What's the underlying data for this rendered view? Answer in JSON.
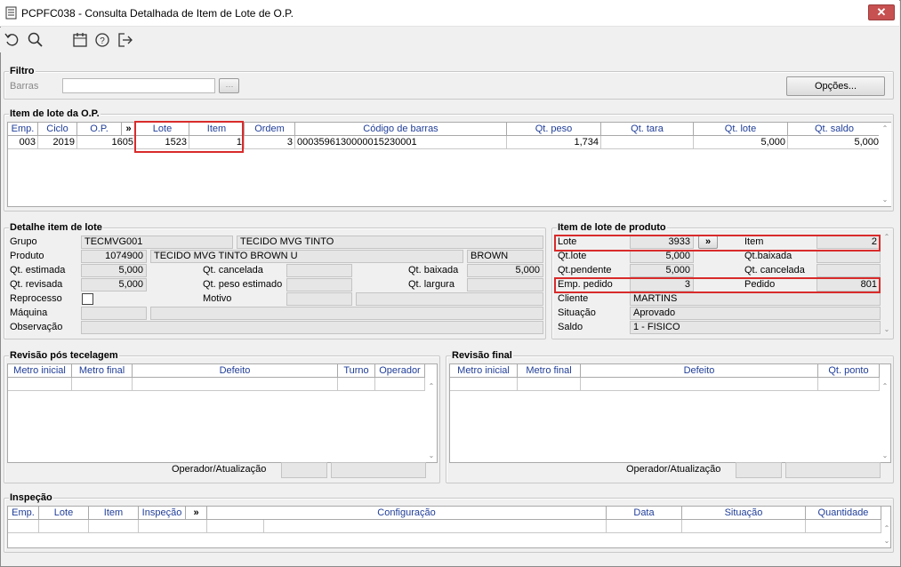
{
  "window": {
    "title": "PCPFC038 - Consulta Detalhada de Item de Lote de O.P.",
    "close_glyph": "✕"
  },
  "toolbar": {
    "icons": [
      "refresh-icon",
      "search-icon",
      "calendar-icon",
      "help-icon",
      "exit-icon"
    ]
  },
  "filtro": {
    "title": "Filtro",
    "barras_label": "Barras",
    "barras_value": "",
    "opcoes_label": "Opções..."
  },
  "item_lote_op": {
    "title": "Item de lote da O.P.",
    "headers": [
      "Emp.",
      "Ciclo",
      "O.P.",
      "»",
      "Lote",
      "Item",
      "Ordem",
      "Código de barras",
      "Qt. peso",
      "Qt. tara",
      "Qt. lote",
      "Qt. saldo"
    ],
    "rows": [
      [
        "003",
        "2019",
        "1605",
        "",
        "1523",
        "1",
        "3",
        "0003596130000015230001",
        "1,734",
        "",
        "5,000",
        "5,000"
      ]
    ]
  },
  "detalhe": {
    "title": "Detalhe item de lote",
    "grupo_label": "Grupo",
    "grupo_code": "TECMVG001",
    "grupo_desc": "TECIDO MVG TINTO",
    "produto_label": "Produto",
    "produto_code": "1074900",
    "produto_desc": "TECIDO MVG TINTO BROWN U",
    "produto_cor": "BROWN",
    "qt_estimada_label": "Qt. estimada",
    "qt_estimada": "5,000",
    "qt_cancelada_label": "Qt. cancelada",
    "qt_cancelada": "",
    "qt_baixada_label": "Qt. baixada",
    "qt_baixada": "5,000",
    "qt_revisada_label": "Qt. revisada",
    "qt_revisada": "5,000",
    "qt_peso_estimado_label": "Qt. peso estimado",
    "qt_peso_estimado": "",
    "qt_largura_label": "Qt. largura",
    "qt_largura": "",
    "reprocesso_label": "Reprocesso",
    "motivo_label": "Motivo",
    "maquina_label": "Máquina",
    "observacao_label": "Observação"
  },
  "produto": {
    "title": "Item de lote de produto",
    "lote_label": "Lote",
    "lote": "3933",
    "more_glyph": "»",
    "item_label": "Item",
    "item": "2",
    "qtlote_label": "Qt.lote",
    "qtlote": "5,000",
    "qtbaixada_label": "Qt.baixada",
    "qtbaixada": "",
    "qtpendente_label": "Qt.pendente",
    "qtpendente": "5,000",
    "qtcancelada_label": "Qt. cancelada",
    "qtcancelada": "",
    "emp_pedido_label": "Emp. pedido",
    "emp_pedido": "3",
    "pedido_label": "Pedido",
    "pedido": "801",
    "cliente_label": "Cliente",
    "cliente": "MARTINS",
    "situacao_label": "Situação",
    "situacao": "Aprovado",
    "saldo_label": "Saldo",
    "saldo": "1 - FISICO"
  },
  "revisao_tecelagem": {
    "title": "Revisão pós tecelagem",
    "headers": [
      "Metro inicial",
      "Metro final",
      "Defeito",
      "Turno",
      "Operador"
    ],
    "operador_label": "Operador/Atualização"
  },
  "revisao_final": {
    "title": "Revisão final",
    "headers": [
      "Metro inicial",
      "Metro final",
      "Defeito",
      "Qt. ponto"
    ],
    "operador_label": "Operador/Atualização"
  },
  "inspecao": {
    "title": "Inspeção",
    "headers": [
      "Emp.",
      "Lote",
      "Item",
      "Inspeção",
      "»",
      "Configuração",
      "Data",
      "Situação",
      "Quantidade"
    ]
  },
  "colors": {
    "header_text": "#1f3d99",
    "highlight": "#d92b2b",
    "close": "#c75050"
  }
}
